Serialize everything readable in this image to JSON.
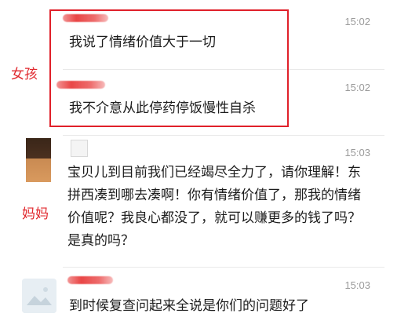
{
  "labels": {
    "girl": "女孩",
    "mom": "妈妈"
  },
  "messages": [
    {
      "time": "15:02",
      "text": "我说了情绪价值大于一切"
    },
    {
      "time": "15:02",
      "text": "我不介意从此停药停饭慢性自杀"
    },
    {
      "time": "15:03",
      "text": "宝贝儿到目前我们已经竭尽全力了，请你理解！东拼西凑到哪去凑啊！你有情绪价值了，那我的情绪价值呢？我良心都没了，就可以赚更多的钱了吗？是真的吗？"
    },
    {
      "time": "15:03",
      "text": "到时候复查问起来全说是你们的问题好了"
    }
  ],
  "colors": {
    "highlight_frame": "#e0202a",
    "label_text": "#e0282d",
    "redaction": "#e83c3c"
  }
}
